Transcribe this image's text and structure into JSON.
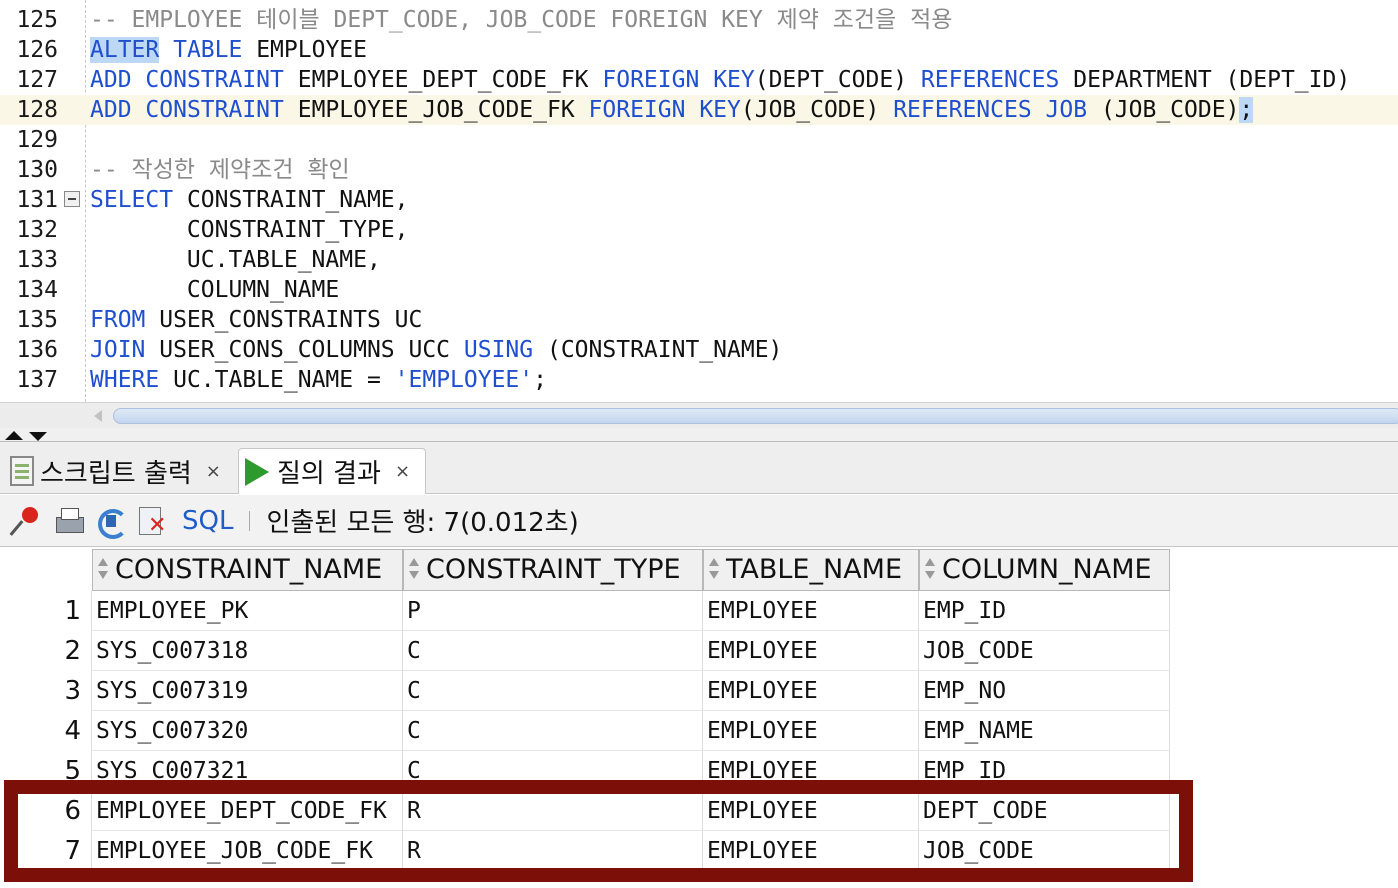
{
  "editor": {
    "lines": [
      {
        "num": "125",
        "tokens": [
          {
            "t": "-- EMPLOYEE 테이블 DEPT_CODE, JOB_CODE FOREIGN KEY 제약 조건을 적용",
            "c": "cm"
          }
        ]
      },
      {
        "num": "126",
        "tokens": [
          {
            "t": "ALTER",
            "c": "kw hl"
          },
          {
            "t": " ",
            "c": "pl"
          },
          {
            "t": "TABLE",
            "c": "kw"
          },
          {
            "t": " EMPLOYEE",
            "c": "pl"
          }
        ]
      },
      {
        "num": "127",
        "tokens": [
          {
            "t": "ADD",
            "c": "kw"
          },
          {
            "t": " ",
            "c": "pl"
          },
          {
            "t": "CONSTRAINT",
            "c": "kw"
          },
          {
            "t": " EMPLOYEE_DEPT_CODE_FK ",
            "c": "pl"
          },
          {
            "t": "FOREIGN",
            "c": "kw"
          },
          {
            "t": " ",
            "c": "pl"
          },
          {
            "t": "KEY",
            "c": "kw"
          },
          {
            "t": "(DEPT_CODE) ",
            "c": "pl"
          },
          {
            "t": "REFERENCES",
            "c": "kw"
          },
          {
            "t": " DEPARTMENT (DEPT_ID)",
            "c": "pl"
          }
        ]
      },
      {
        "num": "128",
        "current": true,
        "tokens": [
          {
            "t": "ADD",
            "c": "kw"
          },
          {
            "t": " ",
            "c": "pl"
          },
          {
            "t": "CONSTRAINT",
            "c": "kw"
          },
          {
            "t": " EMPLOYEE_JOB_CODE_FK ",
            "c": "pl"
          },
          {
            "t": "FOREIGN",
            "c": "kw"
          },
          {
            "t": " ",
            "c": "pl"
          },
          {
            "t": "KEY",
            "c": "kw"
          },
          {
            "t": "(JOB_CODE) ",
            "c": "pl"
          },
          {
            "t": "REFERENCES",
            "c": "kw"
          },
          {
            "t": " ",
            "c": "pl"
          },
          {
            "t": "JOB",
            "c": "kw"
          },
          {
            "t": " (JOB_CODE)",
            "c": "pl"
          },
          {
            "t": ";",
            "c": "pl hl"
          }
        ]
      },
      {
        "num": "129",
        "tokens": []
      },
      {
        "num": "130",
        "tokens": [
          {
            "t": "-- 작성한 제약조건 확인",
            "c": "cm"
          }
        ]
      },
      {
        "num": "131",
        "fold": true,
        "tokens": [
          {
            "t": "SELECT",
            "c": "kw"
          },
          {
            "t": " CONSTRAINT_NAME,",
            "c": "pl"
          }
        ]
      },
      {
        "num": "132",
        "tokens": [
          {
            "t": "       CONSTRAINT_TYPE,",
            "c": "pl"
          }
        ]
      },
      {
        "num": "133",
        "tokens": [
          {
            "t": "       UC.TABLE_NAME,",
            "c": "pl"
          }
        ]
      },
      {
        "num": "134",
        "tokens": [
          {
            "t": "       COLUMN_NAME",
            "c": "pl"
          }
        ]
      },
      {
        "num": "135",
        "tokens": [
          {
            "t": "FROM",
            "c": "kw"
          },
          {
            "t": " USER_CONSTRAINTS UC",
            "c": "pl"
          }
        ]
      },
      {
        "num": "136",
        "tokens": [
          {
            "t": "JOIN",
            "c": "kw"
          },
          {
            "t": " USER_CONS_COLUMNS UCC ",
            "c": "pl"
          },
          {
            "t": "USING",
            "c": "kw"
          },
          {
            "t": " (CONSTRAINT_NAME)",
            "c": "pl"
          }
        ]
      },
      {
        "num": "137",
        "tokens": [
          {
            "t": "WHERE",
            "c": "kw"
          },
          {
            "t": " UC.TABLE_NAME = ",
            "c": "pl"
          },
          {
            "t": "'EMPLOYEE'",
            "c": "str"
          },
          {
            "t": ";",
            "c": "pl"
          }
        ]
      }
    ]
  },
  "tabs": {
    "script_output": {
      "label": "스크립트 출력",
      "close": "×"
    },
    "query_result": {
      "label": "질의 결과",
      "close": "×"
    }
  },
  "toolbar": {
    "sql_label": "SQL",
    "status": "인출된 모든 행: 7(0.012초)"
  },
  "grid": {
    "columns": [
      "CONSTRAINT_NAME",
      "CONSTRAINT_TYPE",
      "TABLE_NAME",
      "COLUMN_NAME"
    ],
    "rows": [
      {
        "num": "1",
        "cells": [
          "EMPLOYEE_PK",
          "P",
          "EMPLOYEE",
          "EMP_ID"
        ]
      },
      {
        "num": "2",
        "cells": [
          "SYS_C007318",
          "C",
          "EMPLOYEE",
          "JOB_CODE"
        ]
      },
      {
        "num": "3",
        "cells": [
          "SYS_C007319",
          "C",
          "EMPLOYEE",
          "EMP_NO"
        ]
      },
      {
        "num": "4",
        "cells": [
          "SYS_C007320",
          "C",
          "EMPLOYEE",
          "EMP_NAME"
        ]
      },
      {
        "num": "5",
        "cells": [
          "SYS_C007321",
          "C",
          "EMPLOYEE",
          "EMP_ID"
        ]
      },
      {
        "num": "6",
        "cells": [
          "EMPLOYEE_DEPT_CODE_FK",
          "R",
          "EMPLOYEE",
          "DEPT_CODE"
        ]
      },
      {
        "num": "7",
        "cells": [
          "EMPLOYEE_JOB_CODE_FK",
          "R",
          "EMPLOYEE",
          "JOB_CODE"
        ]
      }
    ]
  },
  "colors": {
    "keyword": "#1f4fcf",
    "comment": "#8a8a8a",
    "selection": "#bcd8f5",
    "highlight_box": "#7c1008"
  }
}
